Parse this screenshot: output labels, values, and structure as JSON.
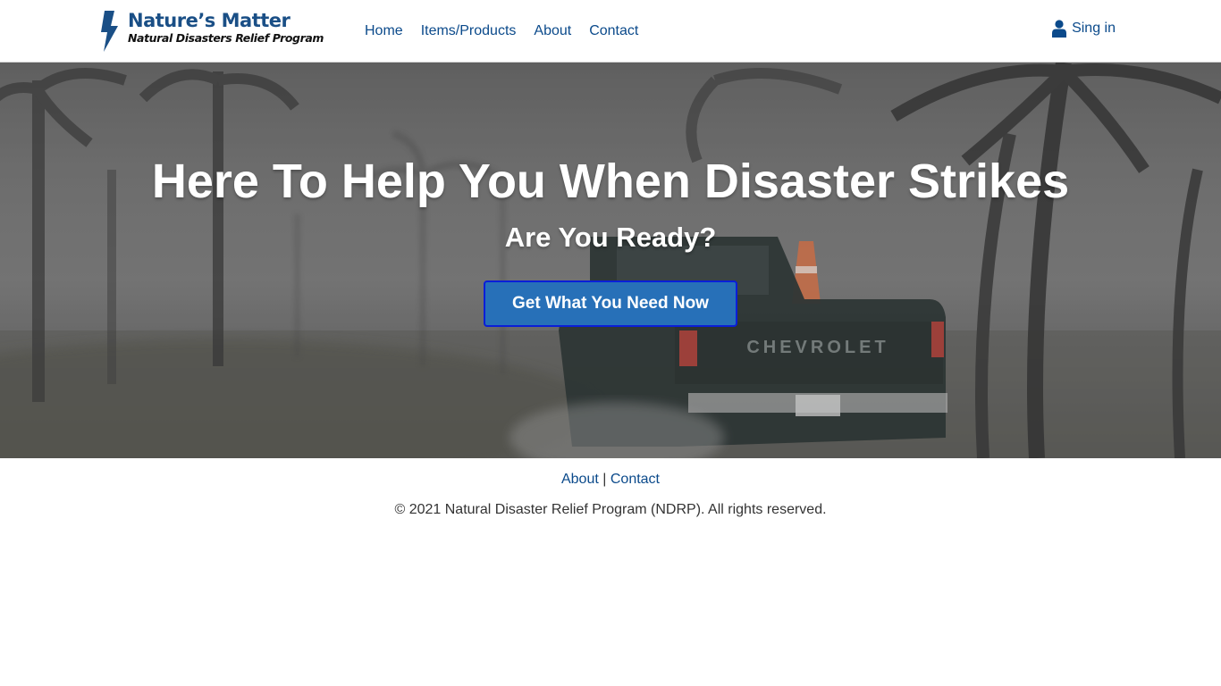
{
  "brand": {
    "title": "Nature’s Matter",
    "subtitle": "Natural Disasters Relief Program",
    "icon": "lightning-bolt-icon",
    "color": "#1a4f86"
  },
  "nav": {
    "items": [
      {
        "label": "Home"
      },
      {
        "label": "Items/Products"
      },
      {
        "label": "About"
      },
      {
        "label": "Contact"
      }
    ],
    "signin_label": "Sing in",
    "signin_icon": "user-icon"
  },
  "hero": {
    "title": "Here To Help You When Disaster Strikes",
    "subtitle": "Are You Ready?",
    "cta_label": "Get What You Need Now",
    "truck_text": "CHEVROLET",
    "cta_color": "#2770b8"
  },
  "footer": {
    "links": [
      {
        "label": "About"
      },
      {
        "label": "Contact"
      }
    ],
    "separator": "|",
    "copyright": "© 2021 Natural Disaster Relief Program (NDRP). All rights reserved."
  },
  "colors": {
    "link": "#0b4a8b"
  }
}
